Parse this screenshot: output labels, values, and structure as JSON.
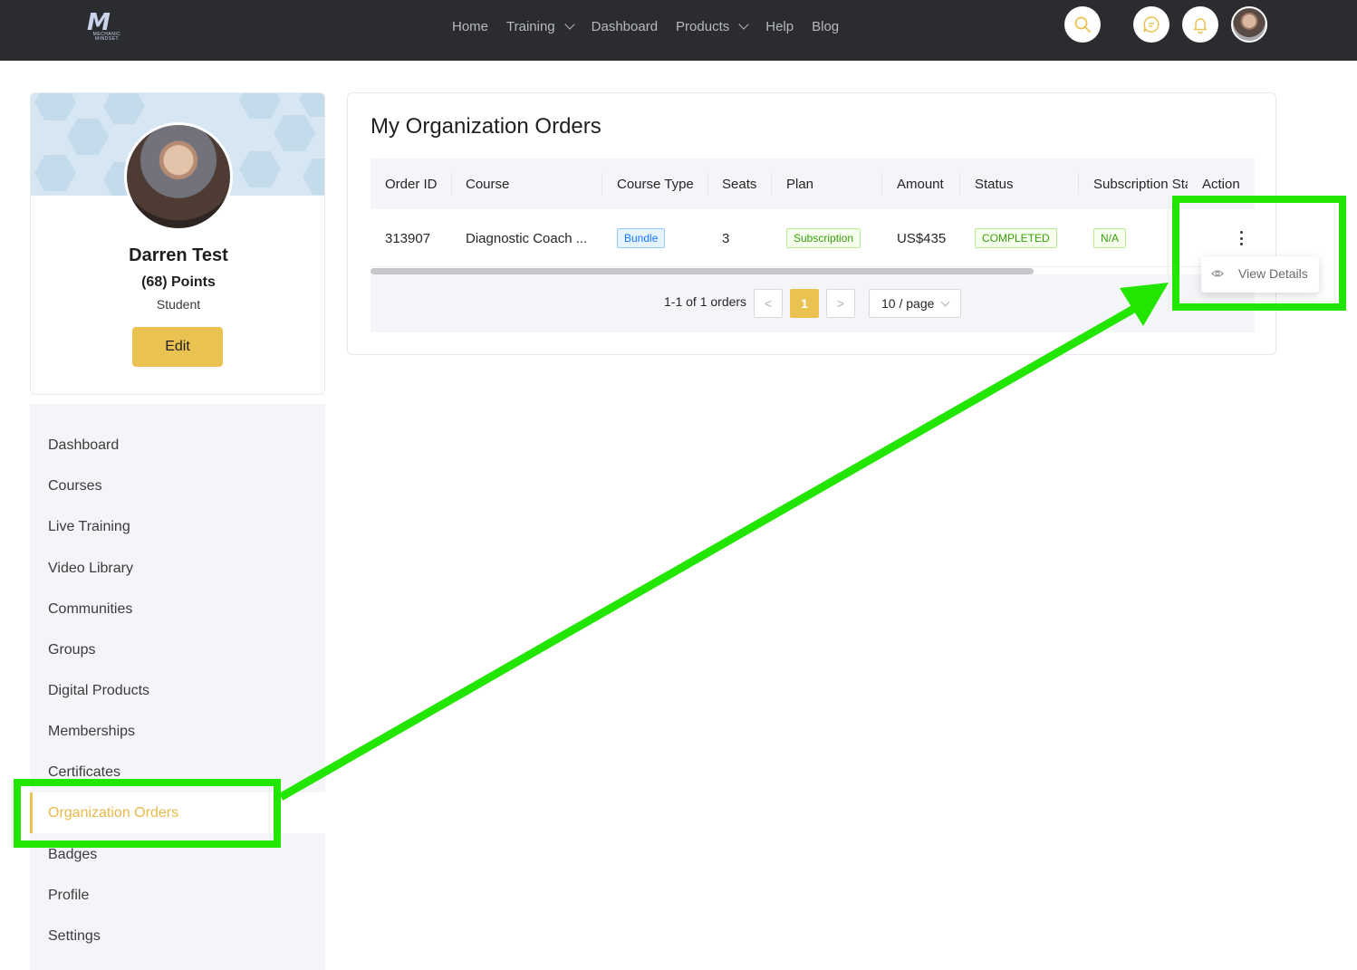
{
  "brand": {
    "logo_mark": "M",
    "logo_text": "MECHANIC MINDSET"
  },
  "nav": {
    "items": [
      {
        "label": "Home",
        "dropdown": false
      },
      {
        "label": "Training",
        "dropdown": true
      },
      {
        "label": "Dashboard",
        "dropdown": false
      },
      {
        "label": "Products",
        "dropdown": true
      },
      {
        "label": "Help",
        "dropdown": false
      },
      {
        "label": "Blog",
        "dropdown": false
      }
    ],
    "icons": [
      "search-icon",
      "chat-icon",
      "bell-icon",
      "avatar"
    ],
    "accent_color": "#e9c251"
  },
  "profile": {
    "name": "Darren Test",
    "points": "(68) Points",
    "role": "Student",
    "edit_label": "Edit"
  },
  "sidebar": {
    "items": [
      {
        "label": "Dashboard"
      },
      {
        "label": "Courses"
      },
      {
        "label": "Live Training"
      },
      {
        "label": "Video Library"
      },
      {
        "label": "Communities"
      },
      {
        "label": "Groups"
      },
      {
        "label": "Digital Products"
      },
      {
        "label": "Memberships"
      },
      {
        "label": "Certificates"
      },
      {
        "label": "Organization Orders",
        "active": true
      },
      {
        "label": "Badges"
      },
      {
        "label": "Profile"
      },
      {
        "label": "Settings"
      }
    ]
  },
  "orders": {
    "title": "My Organization Orders",
    "columns": [
      "Order ID",
      "Course",
      "Course Type",
      "Seats",
      "Plan",
      "Amount",
      "Status",
      "Subscription Sta",
      "Action"
    ],
    "rows": [
      {
        "order_id": "313907",
        "course": "Diagnostic Coach ...",
        "course_type": "Bundle",
        "seats": "3",
        "plan": "Subscription",
        "amount": "US$435",
        "status": "COMPLETED",
        "subscription_status": "N/A"
      }
    ],
    "pagination": {
      "summary": "1-1 of 1 orders",
      "prev": "<",
      "current_page": "1",
      "next": ">",
      "page_size": "10 / page"
    },
    "action_menu": {
      "view_details_label": "View Details"
    }
  },
  "annotation": {
    "color": "#22e500"
  }
}
